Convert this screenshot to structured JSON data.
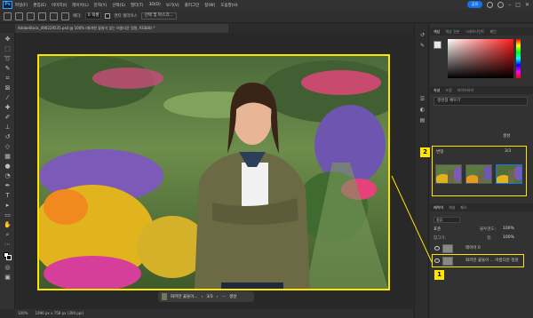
{
  "app": {
    "logo": "Ps"
  },
  "menu": [
    "파일(F)",
    "편집(E)",
    "이미지(I)",
    "레이어(L)",
    "문자(Y)",
    "선택(S)",
    "필터(T)",
    "3D(D)",
    "보기(V)",
    "플러그인",
    "창(W)",
    "도움말(H)"
  ],
  "topright": {
    "share_label": "공유"
  },
  "options": {
    "feather_label": "페더:",
    "feather_value": "0 픽셀",
    "antialias_label": "앤티 앨리어스",
    "select_mask_label": "선택 및 마스크..."
  },
  "document": {
    "tab_title": "AdobeStock_496229535.psd @ 100% (화려한 꽃들이 있는 아름다운 정원, RGB/8) *"
  },
  "floatbar": {
    "label": "화려한 꽃들이...",
    "page": "3/3",
    "generate_label": "생성"
  },
  "status": {
    "zoom": "100%",
    "doc_size": "1096 px x 758 px (300 ppi)"
  },
  "panels": {
    "color_tabs": [
      "색상",
      "색상 견본",
      "그레이디언트",
      "패턴"
    ],
    "properties_tabs": [
      "속성",
      "조정",
      "라이브러리"
    ],
    "prompt_label": "생성형 채우기",
    "generate_label": "생성",
    "variations_label": "변형",
    "variations_count": "3/3",
    "layers_tabs": [
      "레이어",
      "채널",
      "패스"
    ],
    "layers_search": "종류",
    "blend_mode": "표준",
    "opacity_label": "불투명도:",
    "opacity_value": "100%",
    "fill_label": "칠:",
    "fill_value": "100%",
    "lock_label": "잠그기:",
    "layers": [
      {
        "name": "레이어 0"
      },
      {
        "name": "화려한 꽃들이 ... 아름다운 정원"
      }
    ]
  },
  "callouts": {
    "one": "1",
    "two": "2"
  },
  "colors": {
    "highlight": "#ffe600",
    "accent": "#1473e6"
  }
}
